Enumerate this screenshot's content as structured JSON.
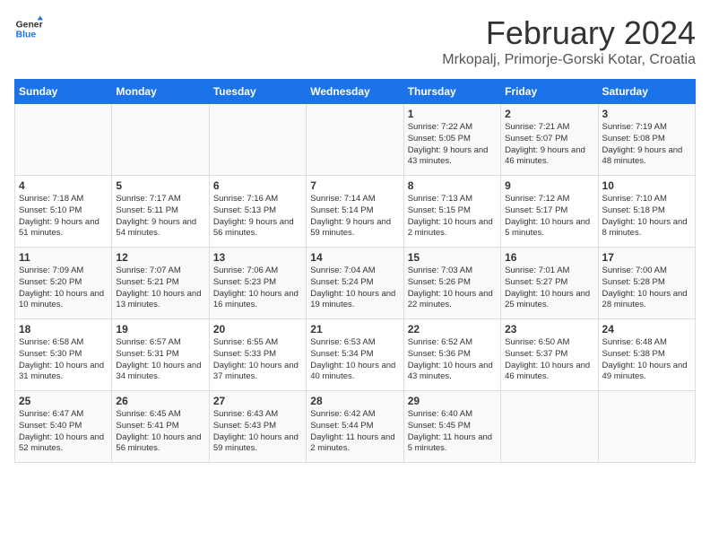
{
  "header": {
    "logo_line1": "General",
    "logo_line2": "Blue",
    "title": "February 2024",
    "subtitle": "Mrkopalj, Primorje-Gorski Kotar, Croatia"
  },
  "days_of_week": [
    "Sunday",
    "Monday",
    "Tuesday",
    "Wednesday",
    "Thursday",
    "Friday",
    "Saturday"
  ],
  "weeks": [
    [
      {
        "day": "",
        "info": ""
      },
      {
        "day": "",
        "info": ""
      },
      {
        "day": "",
        "info": ""
      },
      {
        "day": "",
        "info": ""
      },
      {
        "day": "1",
        "info": "Sunrise: 7:22 AM\nSunset: 5:05 PM\nDaylight: 9 hours\nand 43 minutes."
      },
      {
        "day": "2",
        "info": "Sunrise: 7:21 AM\nSunset: 5:07 PM\nDaylight: 9 hours\nand 46 minutes."
      },
      {
        "day": "3",
        "info": "Sunrise: 7:19 AM\nSunset: 5:08 PM\nDaylight: 9 hours\nand 48 minutes."
      }
    ],
    [
      {
        "day": "4",
        "info": "Sunrise: 7:18 AM\nSunset: 5:10 PM\nDaylight: 9 hours\nand 51 minutes."
      },
      {
        "day": "5",
        "info": "Sunrise: 7:17 AM\nSunset: 5:11 PM\nDaylight: 9 hours\nand 54 minutes."
      },
      {
        "day": "6",
        "info": "Sunrise: 7:16 AM\nSunset: 5:13 PM\nDaylight: 9 hours\nand 56 minutes."
      },
      {
        "day": "7",
        "info": "Sunrise: 7:14 AM\nSunset: 5:14 PM\nDaylight: 9 hours\nand 59 minutes."
      },
      {
        "day": "8",
        "info": "Sunrise: 7:13 AM\nSunset: 5:15 PM\nDaylight: 10 hours\nand 2 minutes."
      },
      {
        "day": "9",
        "info": "Sunrise: 7:12 AM\nSunset: 5:17 PM\nDaylight: 10 hours\nand 5 minutes."
      },
      {
        "day": "10",
        "info": "Sunrise: 7:10 AM\nSunset: 5:18 PM\nDaylight: 10 hours\nand 8 minutes."
      }
    ],
    [
      {
        "day": "11",
        "info": "Sunrise: 7:09 AM\nSunset: 5:20 PM\nDaylight: 10 hours\nand 10 minutes."
      },
      {
        "day": "12",
        "info": "Sunrise: 7:07 AM\nSunset: 5:21 PM\nDaylight: 10 hours\nand 13 minutes."
      },
      {
        "day": "13",
        "info": "Sunrise: 7:06 AM\nSunset: 5:23 PM\nDaylight: 10 hours\nand 16 minutes."
      },
      {
        "day": "14",
        "info": "Sunrise: 7:04 AM\nSunset: 5:24 PM\nDaylight: 10 hours\nand 19 minutes."
      },
      {
        "day": "15",
        "info": "Sunrise: 7:03 AM\nSunset: 5:26 PM\nDaylight: 10 hours\nand 22 minutes."
      },
      {
        "day": "16",
        "info": "Sunrise: 7:01 AM\nSunset: 5:27 PM\nDaylight: 10 hours\nand 25 minutes."
      },
      {
        "day": "17",
        "info": "Sunrise: 7:00 AM\nSunset: 5:28 PM\nDaylight: 10 hours\nand 28 minutes."
      }
    ],
    [
      {
        "day": "18",
        "info": "Sunrise: 6:58 AM\nSunset: 5:30 PM\nDaylight: 10 hours\nand 31 minutes."
      },
      {
        "day": "19",
        "info": "Sunrise: 6:57 AM\nSunset: 5:31 PM\nDaylight: 10 hours\nand 34 minutes."
      },
      {
        "day": "20",
        "info": "Sunrise: 6:55 AM\nSunset: 5:33 PM\nDaylight: 10 hours\nand 37 minutes."
      },
      {
        "day": "21",
        "info": "Sunrise: 6:53 AM\nSunset: 5:34 PM\nDaylight: 10 hours\nand 40 minutes."
      },
      {
        "day": "22",
        "info": "Sunrise: 6:52 AM\nSunset: 5:36 PM\nDaylight: 10 hours\nand 43 minutes."
      },
      {
        "day": "23",
        "info": "Sunrise: 6:50 AM\nSunset: 5:37 PM\nDaylight: 10 hours\nand 46 minutes."
      },
      {
        "day": "24",
        "info": "Sunrise: 6:48 AM\nSunset: 5:38 PM\nDaylight: 10 hours\nand 49 minutes."
      }
    ],
    [
      {
        "day": "25",
        "info": "Sunrise: 6:47 AM\nSunset: 5:40 PM\nDaylight: 10 hours\nand 52 minutes."
      },
      {
        "day": "26",
        "info": "Sunrise: 6:45 AM\nSunset: 5:41 PM\nDaylight: 10 hours\nand 56 minutes."
      },
      {
        "day": "27",
        "info": "Sunrise: 6:43 AM\nSunset: 5:43 PM\nDaylight: 10 hours\nand 59 minutes."
      },
      {
        "day": "28",
        "info": "Sunrise: 6:42 AM\nSunset: 5:44 PM\nDaylight: 11 hours\nand 2 minutes."
      },
      {
        "day": "29",
        "info": "Sunrise: 6:40 AM\nSunset: 5:45 PM\nDaylight: 11 hours\nand 5 minutes."
      },
      {
        "day": "",
        "info": ""
      },
      {
        "day": "",
        "info": ""
      }
    ]
  ]
}
